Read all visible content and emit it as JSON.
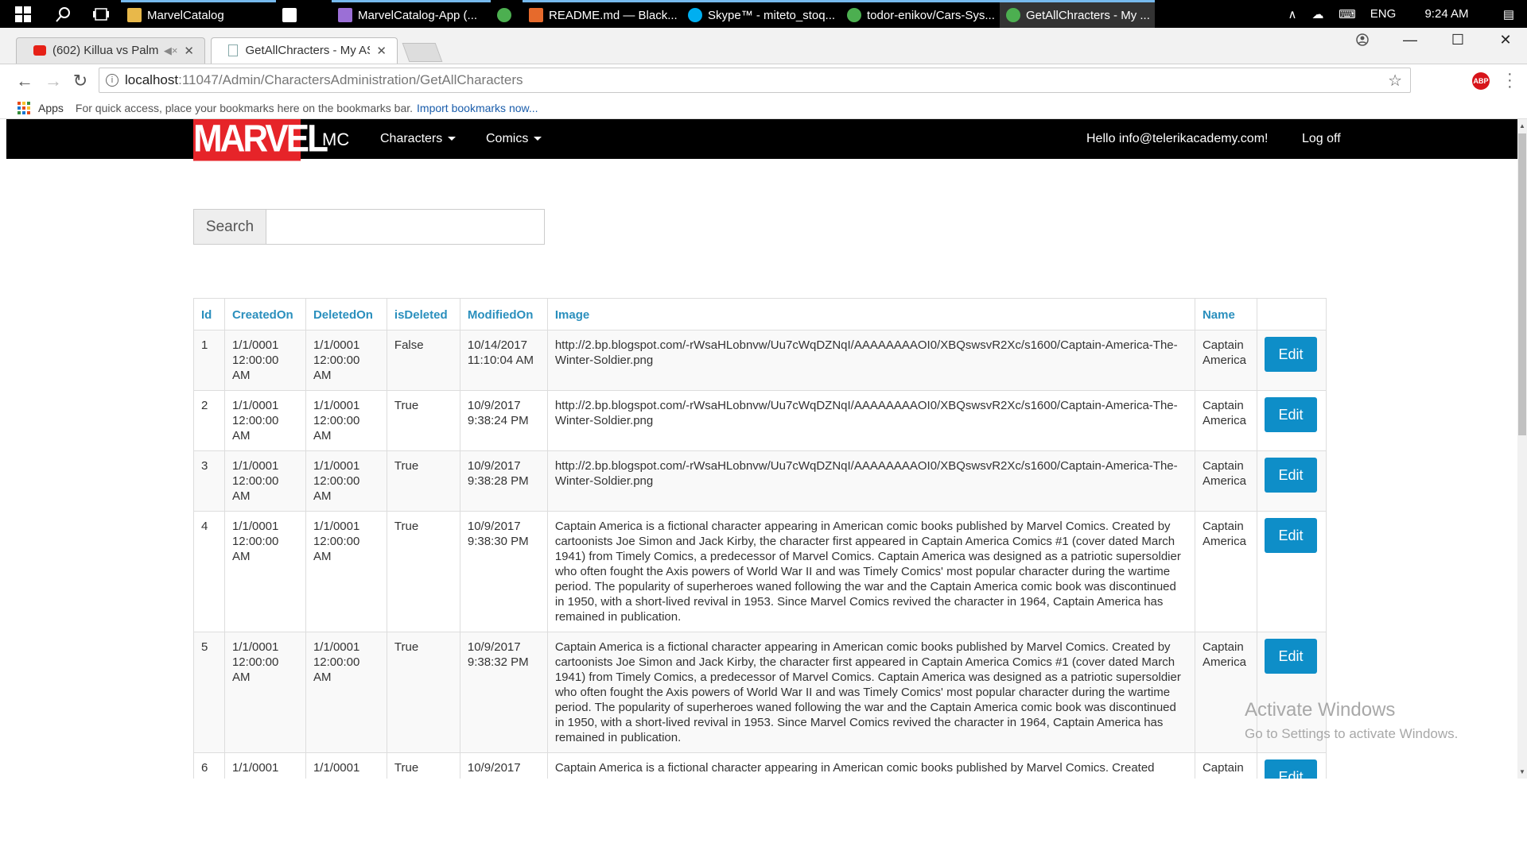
{
  "taskbar": {
    "apps": [
      {
        "label": "MarvelCatalog",
        "icon": "folder-icon"
      },
      {
        "label": "",
        "icon": "mail-icon"
      },
      {
        "label": "MarvelCatalog-App (...",
        "icon": "visual-studio-icon"
      },
      {
        "label": "",
        "icon": "chrome-icon"
      },
      {
        "label": "README.md — Black...",
        "icon": "code-editor-icon"
      },
      {
        "label": "Skype™ - miteto_stoq...",
        "icon": "skype-icon"
      },
      {
        "label": "todor-enikov/Cars-Sys...",
        "icon": "chrome-icon"
      },
      {
        "label": "GetAllChracters - My ...",
        "icon": "chrome-icon"
      }
    ],
    "language": "ENG",
    "time": "9:24 AM"
  },
  "browser": {
    "tabs": [
      {
        "label": "(602) Killua vs Palm -",
        "icon": "youtube-icon"
      },
      {
        "label": "GetAllChracters - My ASP",
        "icon": "page-icon"
      }
    ],
    "url_host": "localhost",
    "url_path": ":11047/Admin/CharactersAdministration/GetAllCharacters",
    "bookmarks_apps": "Apps",
    "bookmarks_hint": "For quick access, place your bookmarks here on the bookmarks bar.",
    "bookmarks_import": "Import bookmarks now..."
  },
  "navbar": {
    "logo": "MARVEL",
    "brand": "MC",
    "characters": "Characters",
    "comics": "Comics",
    "greeting": "Hello info@telerikacademy.com!",
    "logoff": "Log off"
  },
  "search": {
    "label": "Search",
    "value": ""
  },
  "table": {
    "headers": [
      "Id",
      "CreatedOn",
      "DeletedOn",
      "isDeleted",
      "ModifiedOn",
      "Image",
      "Name",
      ""
    ],
    "edit_label": "Edit",
    "rows": [
      {
        "id": "1",
        "created": "1/1/0001 12:00:00 AM",
        "deleted": "1/1/0001 12:00:00 AM",
        "isDeleted": "False",
        "modified": "10/14/2017 11:10:04 AM",
        "image": "http://2.bp.blogspot.com/-rWsaHLobnvw/Uu7cWqDZNqI/AAAAAAAAOI0/XBQswsvR2Xc/s1600/Captain-America-The-Winter-Soldier.png",
        "name": "Captain America"
      },
      {
        "id": "2",
        "created": "1/1/0001 12:00:00 AM",
        "deleted": "1/1/0001 12:00:00 AM",
        "isDeleted": "True",
        "modified": "10/9/2017 9:38:24 PM",
        "image": "http://2.bp.blogspot.com/-rWsaHLobnvw/Uu7cWqDZNqI/AAAAAAAAOI0/XBQswsvR2Xc/s1600/Captain-America-The-Winter-Soldier.png",
        "name": "Captain America"
      },
      {
        "id": "3",
        "created": "1/1/0001 12:00:00 AM",
        "deleted": "1/1/0001 12:00:00 AM",
        "isDeleted": "True",
        "modified": "10/9/2017 9:38:28 PM",
        "image": "http://2.bp.blogspot.com/-rWsaHLobnvw/Uu7cWqDZNqI/AAAAAAAAOI0/XBQswsvR2Xc/s1600/Captain-America-The-Winter-Soldier.png",
        "name": "Captain America"
      },
      {
        "id": "4",
        "created": "1/1/0001 12:00:00 AM",
        "deleted": "1/1/0001 12:00:00 AM",
        "isDeleted": "True",
        "modified": "10/9/2017 9:38:30 PM",
        "image": "Captain America is a fictional character appearing in American comic books published by Marvel Comics. Created by cartoonists Joe Simon and Jack Kirby, the character first appeared in Captain America Comics #1 (cover dated March 1941) from Timely Comics, a predecessor of Marvel Comics. Captain America was designed as a patriotic supersoldier who often fought the Axis powers of World War II and was Timely Comics' most popular character during the wartime period. The popularity of superheroes waned following the war and the Captain America comic book was discontinued in 1950, with a short-lived revival in 1953. Since Marvel Comics revived the character in 1964, Captain America has remained in publication.",
        "name": "Captain America"
      },
      {
        "id": "5",
        "created": "1/1/0001 12:00:00 AM",
        "deleted": "1/1/0001 12:00:00 AM",
        "isDeleted": "True",
        "modified": "10/9/2017 9:38:32 PM",
        "image": "Captain America is a fictional character appearing in American comic books published by Marvel Comics. Created by cartoonists Joe Simon and Jack Kirby, the character first appeared in Captain America Comics #1 (cover dated March 1941) from Timely Comics, a predecessor of Marvel Comics. Captain America was designed as a patriotic supersoldier who often fought the Axis powers of World War II and was Timely Comics' most popular character during the wartime period. The popularity of superheroes waned following the war and the Captain America comic book was discontinued in 1950, with a short-lived revival in 1953. Since Marvel Comics revived the character in 1964, Captain America has remained in publication.",
        "name": "Captain America"
      },
      {
        "id": "6",
        "created": "1/1/0001",
        "deleted": "1/1/0001",
        "isDeleted": "True",
        "modified": "10/9/2017",
        "image": "Captain America is a fictional character appearing in American comic books published by Marvel Comics. Created",
        "name": "Captain"
      }
    ]
  },
  "watermark": {
    "title": "Activate Windows",
    "subtitle": "Go to Settings to activate Windows."
  },
  "colors": {
    "accent": "#0e8ec8",
    "header_link": "#2a8fbd",
    "marvel_red": "#e62429"
  }
}
